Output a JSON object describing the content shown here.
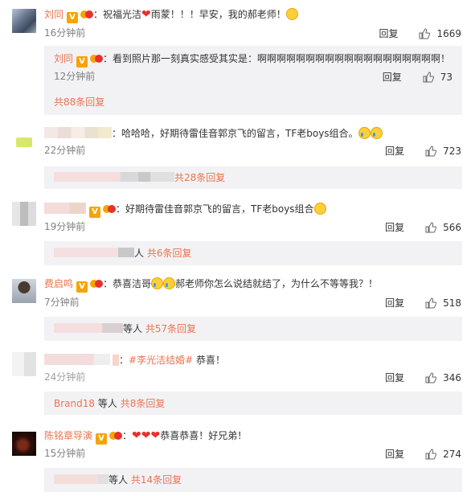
{
  "comments": [
    {
      "user": "刘同",
      "text_a": "：祝福光洁",
      "text_b": "雨蒙！！！早安，我的郝老师！",
      "time": "16分钟前",
      "reply_label": "回复",
      "likes": "1669",
      "sub": {
        "user": "刘同",
        "text": "：看到照片那一刻真实感受其实是：啊啊啊啊啊啊啊啊啊啊啊啊啊啊啊啊啊啊啊！",
        "time": "12分钟前",
        "reply_label": "回复",
        "likes": "73"
      },
      "more_replies": "共88条回复"
    },
    {
      "text": "：哈哈哈，好期待雷佳音郭京飞的留言，TF老boys组合。",
      "time": "22分钟前",
      "reply_label": "回复",
      "likes": "723",
      "more_replies": "共28条回复"
    },
    {
      "text": "：好期待雷佳音郭京飞的留言，TF老boys组合",
      "time": "19分钟前",
      "reply_label": "回复",
      "likes": "566",
      "more_replies_suffix": "人",
      "more_replies": "共6条回复"
    },
    {
      "user": "费启鸣",
      "text_a": "：恭喜洁哥",
      "text_b": "郝老师你怎么说结就结了，为什么不等等我？！",
      "time": "7分钟前",
      "reply_label": "回复",
      "likes": "518",
      "more_replies_prefix": "等人",
      "more_replies": "共57条回复"
    },
    {
      "text_a": "：",
      "hashtag": "#李光洁结婚#",
      "text_b": " 恭喜！",
      "time": "24分钟前",
      "reply_label": "回复",
      "likes": "346",
      "more_replies_user": "Brand18",
      "more_replies_prefix": "等人",
      "more_replies": "共8条回复"
    },
    {
      "user": "陈铭章导演",
      "text_a": "：",
      "text_b": "恭喜恭喜！好兄弟！",
      "time": "15分钟前",
      "reply_label": "回复",
      "likes": "274",
      "more_replies_prefix": "等人",
      "more_replies": "共14条回复"
    }
  ],
  "colors": {
    "link": "#eb7350",
    "meta": "#808080",
    "subbox_bg": "#f2f2f5"
  }
}
